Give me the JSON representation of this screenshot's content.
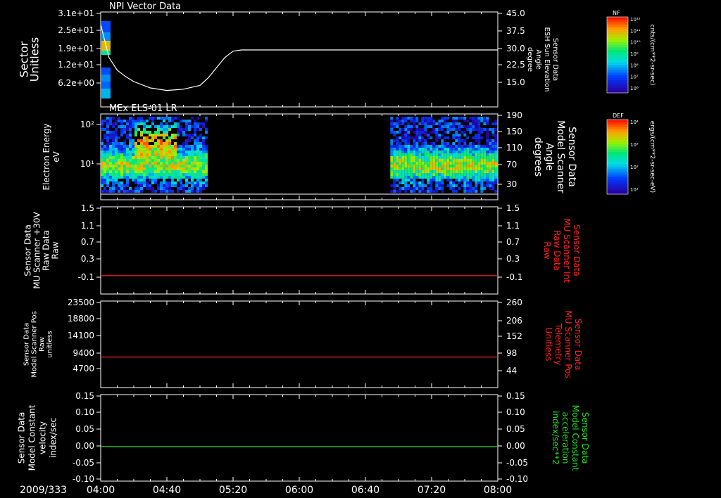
{
  "date_label": "2009/333",
  "time_ticks": [
    "04:00",
    "04:40",
    "05:20",
    "06:00",
    "06:40",
    "07:20",
    "08:00"
  ],
  "colors": {
    "background": "#000000",
    "axis": "#ffffff",
    "red_trace": "#ff2020",
    "green_trace": "#20e020",
    "red_label": "#ff2020",
    "green_label": "#20e020"
  },
  "chart_data": [
    {
      "type": "heatmap",
      "title": "NPI Vector Data",
      "left_label": [
        "Sector",
        "Unitless"
      ],
      "left_ticks": [
        "3.1e+01",
        "2.5e+01",
        "1.9e+01",
        "1.2e+01",
        "6.2e+00"
      ],
      "right_label": [
        "Sensor Data",
        "ESH Sun Elevation",
        "Angle",
        "degree"
      ],
      "right_ticks": [
        "45.0",
        "37.5",
        "30.0",
        "22.5",
        "15.0"
      ],
      "right_ylim": [
        7.5,
        45.0
      ],
      "line_series": {
        "x": [
          "04:00",
          "04:05",
          "04:10",
          "04:15",
          "04:20",
          "04:30",
          "04:40",
          "04:50",
          "05:00",
          "05:05",
          "05:10",
          "05:15",
          "05:20",
          "05:25",
          "05:30",
          "06:00",
          "07:00",
          "08:00"
        ],
        "y": [
          40.0,
          27.0,
          22.0,
          19.5,
          17.5,
          15.0,
          14.0,
          14.5,
          16.0,
          19.0,
          23.0,
          27.0,
          29.5,
          30.0,
          30.0,
          30.0,
          30.0,
          30.0
        ]
      },
      "colorbar": {
        "label": "NF",
        "units": "cnts/(cm**2-sr-sec)",
        "tick_labels": [
          "10¹²",
          "10¹¹",
          "10¹⁰",
          "10⁹",
          "10⁸",
          "10⁷",
          "10⁶"
        ]
      }
    },
    {
      "type": "heatmap",
      "title": "MEx ELS-01 LR",
      "left_label": [
        "Electron Energy",
        "eV"
      ],
      "left_ticks": [
        "10²",
        "10¹"
      ],
      "left_scale": "log",
      "right_label": [
        "Sensor Data",
        "Model Scanner",
        "Angle",
        "degrees"
      ],
      "right_ticks": [
        "190",
        "150",
        "110",
        "70",
        "30"
      ],
      "right_ylim": [
        10,
        190
      ],
      "data_intervals": [
        [
          "04:00",
          "05:05"
        ],
        [
          "06:55",
          "08:00"
        ]
      ],
      "colorbar": {
        "label": "DEF",
        "units": "ergs/(cm**2-sr-sec-eV)",
        "tick_labels": [
          "10⁴",
          "10³",
          "10²",
          "10¹"
        ]
      }
    },
    {
      "type": "line",
      "left_label": [
        "Sensor Data",
        "MU Scanner +30V",
        "Raw Data",
        "Raw"
      ],
      "left_ticks": [
        "1.5",
        "1.1",
        "0.7",
        "0.3",
        "-0.1"
      ],
      "right_label": [
        "Sensor Data",
        "MU Scanner Int",
        "Raw Data",
        "Raw"
      ],
      "right_ticks": [
        "1.5",
        "1.1",
        "0.7",
        "0.3",
        "-0.1"
      ],
      "ylim": [
        -0.4,
        1.5
      ],
      "series": [
        {
          "x": [
            "04:00",
            "08:00"
          ],
          "y": [
            0.0,
            0.0
          ]
        }
      ]
    },
    {
      "type": "line",
      "left_label": [
        "Sensor Data",
        "Model Scanner Pos",
        "Raw",
        "unitless"
      ],
      "left_ticks": [
        "23500",
        "18800",
        "14100",
        "9400",
        "4700"
      ],
      "right_label": [
        "Sensor Data",
        "MU Scanner Pos",
        "Telemetry",
        "Unitless"
      ],
      "right_ticks": [
        "260",
        "206",
        "152",
        "98",
        "44"
      ],
      "ylim": [
        0,
        23500
      ],
      "series": [
        {
          "x": [
            "04:00",
            "08:00"
          ],
          "y": [
            8300,
            8300
          ]
        }
      ]
    },
    {
      "type": "line",
      "left_label": [
        "Sensor Data",
        "Model Constant",
        "velocity",
        "index/sec"
      ],
      "left_ticks": [
        "0.15",
        "0.10",
        "0.05",
        "0.00",
        "-0.05",
        "-0.10"
      ],
      "right_label": [
        "Sensor Data",
        "Model Constant",
        "acceleration",
        "index/sec**2"
      ],
      "right_ticks": [
        "0.15",
        "0.10",
        "0.05",
        "0.00",
        "-0.05",
        "-0.10"
      ],
      "ylim": [
        -0.1,
        0.15
      ],
      "series": [
        {
          "x": [
            "04:00",
            "08:00"
          ],
          "y": [
            0.0,
            0.0
          ]
        }
      ]
    }
  ]
}
